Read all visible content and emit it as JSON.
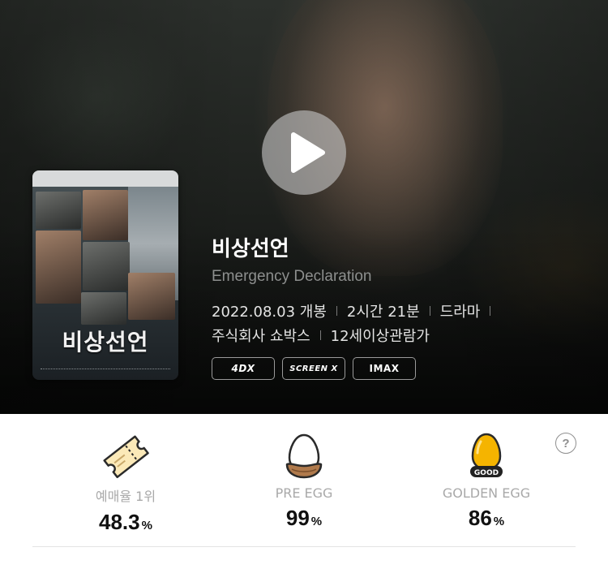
{
  "movie": {
    "title_ko": "비상선언",
    "title_en": "Emergency Declaration",
    "release": "2022.08.03 개봉",
    "runtime": "2시간 21분",
    "genre": "드라마",
    "distributor": "주식회사 쇼박스",
    "rating": "12세이상관람가",
    "formats": [
      "4DX",
      "SCREEN X",
      "IMAX"
    ]
  },
  "poster": {
    "title": "비상선언"
  },
  "stats": [
    {
      "label": "예매율 1위",
      "value": "48.3",
      "unit": "%",
      "icon": "ticket-icon"
    },
    {
      "label": "PRE EGG",
      "value": "99",
      "unit": "%",
      "icon": "pre-egg-icon"
    },
    {
      "label": "GOLDEN EGG",
      "value": "86",
      "unit": "%",
      "icon": "golden-egg-icon",
      "badge": "GOOD"
    }
  ],
  "help_label": "?",
  "colors": {
    "hero_bg": "#1f221f",
    "label_gray": "#a9a9a9",
    "value_black": "#111111",
    "golden": "#f5b400"
  }
}
